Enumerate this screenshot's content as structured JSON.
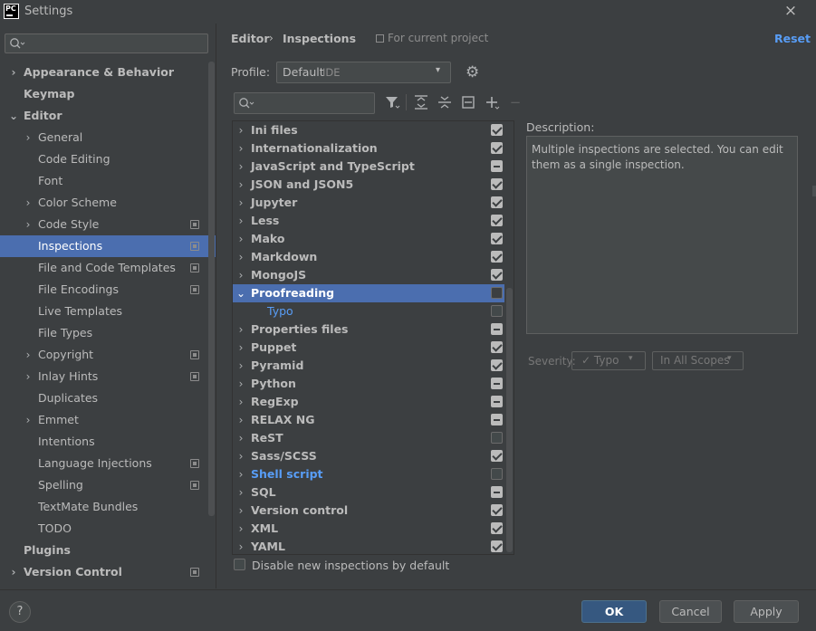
{
  "window": {
    "title": "Settings",
    "logo_text": "PC",
    "close_icon": "×"
  },
  "left_nav": {
    "items": [
      {
        "label": "Appearance & Behavior",
        "level": 0,
        "bold": true,
        "chevron": "›",
        "project": false
      },
      {
        "label": "Keymap",
        "level": 0,
        "bold": true,
        "chevron": "",
        "project": false
      },
      {
        "label": "Editor",
        "level": 0,
        "bold": true,
        "chevron": "⌄",
        "project": false
      },
      {
        "label": "General",
        "level": 1,
        "bold": false,
        "chevron": "›",
        "project": false
      },
      {
        "label": "Code Editing",
        "level": 1,
        "bold": false,
        "chevron": "",
        "project": false
      },
      {
        "label": "Font",
        "level": 1,
        "bold": false,
        "chevron": "",
        "project": false
      },
      {
        "label": "Color Scheme",
        "level": 1,
        "bold": false,
        "chevron": "›",
        "project": false
      },
      {
        "label": "Code Style",
        "level": 1,
        "bold": false,
        "chevron": "›",
        "project": true
      },
      {
        "label": "Inspections",
        "level": 1,
        "bold": false,
        "chevron": "",
        "project": true,
        "selected": true
      },
      {
        "label": "File and Code Templates",
        "level": 1,
        "bold": false,
        "chevron": "",
        "project": true
      },
      {
        "label": "File Encodings",
        "level": 1,
        "bold": false,
        "chevron": "",
        "project": true
      },
      {
        "label": "Live Templates",
        "level": 1,
        "bold": false,
        "chevron": "",
        "project": false
      },
      {
        "label": "File Types",
        "level": 1,
        "bold": false,
        "chevron": "",
        "project": false
      },
      {
        "label": "Copyright",
        "level": 1,
        "bold": false,
        "chevron": "›",
        "project": true
      },
      {
        "label": "Inlay Hints",
        "level": 1,
        "bold": false,
        "chevron": "›",
        "project": true
      },
      {
        "label": "Duplicates",
        "level": 1,
        "bold": false,
        "chevron": "",
        "project": false
      },
      {
        "label": "Emmet",
        "level": 1,
        "bold": false,
        "chevron": "›",
        "project": false
      },
      {
        "label": "Intentions",
        "level": 1,
        "bold": false,
        "chevron": "",
        "project": false
      },
      {
        "label": "Language Injections",
        "level": 1,
        "bold": false,
        "chevron": "",
        "project": true
      },
      {
        "label": "Spelling",
        "level": 1,
        "bold": false,
        "chevron": "",
        "project": true
      },
      {
        "label": "TextMate Bundles",
        "level": 1,
        "bold": false,
        "chevron": "",
        "project": false
      },
      {
        "label": "TODO",
        "level": 1,
        "bold": false,
        "chevron": "",
        "project": false
      },
      {
        "label": "Plugins",
        "level": 0,
        "bold": true,
        "chevron": "",
        "project": false
      },
      {
        "label": "Version Control",
        "level": 0,
        "bold": true,
        "chevron": "›",
        "project": true
      }
    ]
  },
  "header": {
    "breadcrumb_1": "Editor",
    "breadcrumb_sep": "›",
    "breadcrumb_2": "Inspections",
    "for_project": "For current project",
    "reset": "Reset"
  },
  "profile": {
    "label": "Profile:",
    "value": "Default",
    "scope": "IDE",
    "arrow": "▾",
    "gear_icon": "⚙"
  },
  "toolbar": {
    "filter_icon": "▼",
    "expand_icon": "⇞",
    "collapse_icon": "⇟",
    "reset_icon": "⊟",
    "add_icon": "+",
    "remove_icon": "−"
  },
  "tree": {
    "rows": [
      {
        "label": "Ini files",
        "state": "on",
        "chevron": "›"
      },
      {
        "label": "Internationalization",
        "state": "on",
        "chevron": "›"
      },
      {
        "label": "JavaScript and TypeScript",
        "state": "mixed",
        "chevron": "›"
      },
      {
        "label": "JSON and JSON5",
        "state": "on",
        "chevron": "›"
      },
      {
        "label": "Jupyter",
        "state": "on",
        "chevron": "›"
      },
      {
        "label": "Less",
        "state": "on",
        "chevron": "›"
      },
      {
        "label": "Mako",
        "state": "on",
        "chevron": "›"
      },
      {
        "label": "Markdown",
        "state": "on",
        "chevron": "›"
      },
      {
        "label": "MongoJS",
        "state": "on",
        "chevron": "›"
      },
      {
        "label": "Proofreading",
        "state": "off",
        "chevron": "⌄",
        "selected": true
      },
      {
        "label": "Typo",
        "state": "off",
        "chevron": "",
        "child": true,
        "blue": true
      },
      {
        "label": "Properties files",
        "state": "mixed",
        "chevron": "›"
      },
      {
        "label": "Puppet",
        "state": "on",
        "chevron": "›"
      },
      {
        "label": "Pyramid",
        "state": "on",
        "chevron": "›"
      },
      {
        "label": "Python",
        "state": "mixed",
        "chevron": "›"
      },
      {
        "label": "RegExp",
        "state": "mixed",
        "chevron": "›"
      },
      {
        "label": "RELAX NG",
        "state": "mixed",
        "chevron": "›"
      },
      {
        "label": "ReST",
        "state": "off",
        "chevron": "›"
      },
      {
        "label": "Sass/SCSS",
        "state": "on",
        "chevron": "›"
      },
      {
        "label": "Shell script",
        "state": "off",
        "chevron": "›",
        "blue": true
      },
      {
        "label": "SQL",
        "state": "mixed",
        "chevron": "›"
      },
      {
        "label": "Version control",
        "state": "on",
        "chevron": "›"
      },
      {
        "label": "XML",
        "state": "on",
        "chevron": "›"
      },
      {
        "label": "YAML",
        "state": "on",
        "chevron": "›"
      }
    ]
  },
  "description": {
    "label": "Description:",
    "text": "Multiple inspections are selected. You can edit them as a single inspection."
  },
  "severity": {
    "label": "Severity:",
    "value": "Typo",
    "check": "✓",
    "scope": "In All Scopes",
    "arrow": "▾"
  },
  "footer": {
    "disable_new": "Disable new inspections by default"
  },
  "buttons": {
    "help": "?",
    "ok": "OK",
    "cancel": "Cancel",
    "apply": "Apply"
  }
}
